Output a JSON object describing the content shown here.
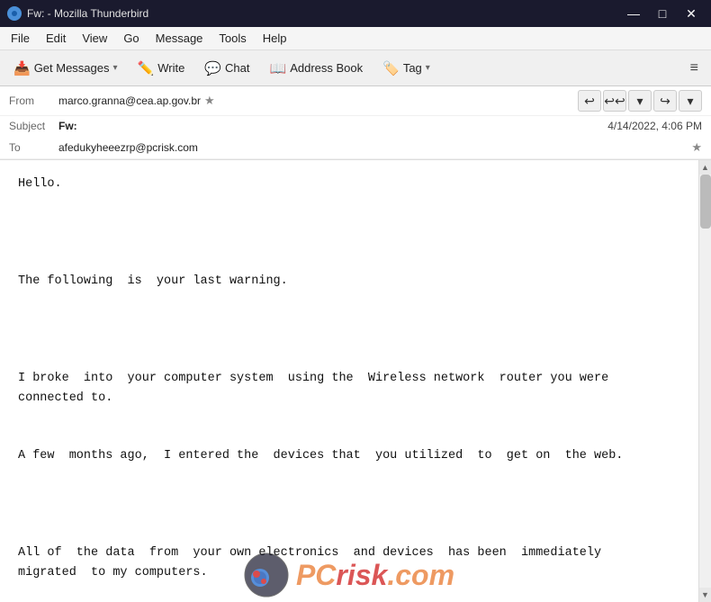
{
  "titlebar": {
    "title": "Fw: - Mozilla Thunderbird",
    "minimize": "—",
    "maximize": "□",
    "close": "✕"
  },
  "menubar": {
    "items": [
      "File",
      "Edit",
      "View",
      "Go",
      "Message",
      "Tools",
      "Help"
    ]
  },
  "toolbar": {
    "get_messages": "Get Messages",
    "write": "Write",
    "chat": "Chat",
    "address_book": "Address Book",
    "tag": "Tag",
    "menu": "≡"
  },
  "email": {
    "from_label": "From",
    "from_value": "marco.granna@cea.ap.gov.br",
    "subject_label": "Subject",
    "subject_value": "Fw:",
    "date": "4/14/2022, 4:06 PM",
    "to_label": "To",
    "to_value": "afedukyheeezrp@pcrisk.com",
    "body": "Hello.\n\n\n\n\nThe following  is  your last warning.\n\n\n\n\nI broke  into  your computer system  using the  Wireless network  router you were\nconnected to.\n\n\nA few  months ago,  I entered the  devices that  you utilized  to  get on  the web.\n\n\n\n\nAll of  the data  from  your own electronics  and devices  has been  immediately\nmigrated  to my computers."
  }
}
